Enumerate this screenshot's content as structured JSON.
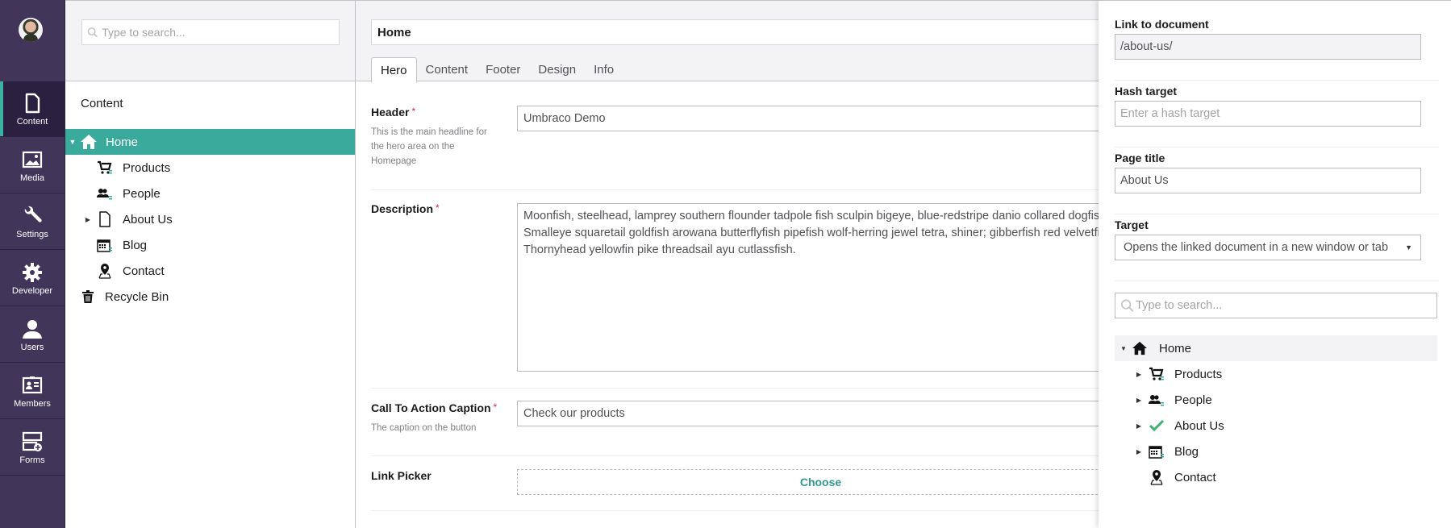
{
  "app_nav": {
    "user": "user-avatar",
    "items": [
      {
        "label": "Content",
        "icon": "document-icon",
        "active": true
      },
      {
        "label": "Media",
        "icon": "image-icon",
        "active": false
      },
      {
        "label": "Settings",
        "icon": "wrench-icon",
        "active": false
      },
      {
        "label": "Developer",
        "icon": "gear-icon",
        "active": false
      },
      {
        "label": "Users",
        "icon": "user-icon",
        "active": false
      },
      {
        "label": "Members",
        "icon": "id-card-icon",
        "active": false
      },
      {
        "label": "Forms",
        "icon": "form-add-icon",
        "active": false
      }
    ]
  },
  "tree": {
    "search_placeholder": "Type to search...",
    "title": "Content",
    "items": [
      {
        "label": "Home",
        "icon": "home-icon",
        "expanded": true,
        "selected": true
      },
      {
        "label": "Products",
        "icon": "shopping-cart-icon"
      },
      {
        "label": "People",
        "icon": "people-icon"
      },
      {
        "label": "About Us",
        "icon": "document-icon",
        "has_children": true
      },
      {
        "label": "Blog",
        "icon": "calendar-icon"
      },
      {
        "label": "Contact",
        "icon": "map-pin-icon"
      },
      {
        "label": "Recycle Bin",
        "icon": "trash-icon"
      }
    ]
  },
  "editor": {
    "node_name": "Home",
    "tabs": [
      {
        "label": "Hero",
        "active": true
      },
      {
        "label": "Content"
      },
      {
        "label": "Footer"
      },
      {
        "label": "Design"
      },
      {
        "label": "Info"
      }
    ],
    "properties": {
      "header": {
        "label": "Header",
        "required": "*",
        "description": "This is the main headline for the hero area on the Homepage",
        "value": "Umbraco Demo"
      },
      "description": {
        "label": "Description",
        "required": "*",
        "value": "Moonfish, steelhead, lamprey southern flounder tadpole fish sculpin bigeye, blue-redstripe danio collared dogfish. Smalleye squaretail goldfish arowana butterflyfish pipefish wolf-herring jewel tetra, shiner; gibberfish red velvetfish. Thornyhead yellowfin pike threadsail ayu cutlassfish."
      },
      "cta": {
        "label": "Call To Action Caption",
        "required": "*",
        "description": "The caption on the button",
        "value": "Check our products"
      },
      "link_picker": {
        "label": "Link Picker",
        "button": "Choose"
      }
    }
  },
  "overlay": {
    "link_label": "Link to document",
    "link_value": "/about-us/",
    "hash_label": "Hash target",
    "hash_placeholder": "Enter a hash target",
    "page_title_label": "Page title",
    "page_title_value": "About Us",
    "target_label": "Target",
    "target_value": "Opens the linked document in a new window or tab",
    "search_placeholder": "Type to search...",
    "tree": [
      {
        "label": "Home",
        "icon": "home-icon",
        "expanded": true,
        "highlighted": true
      },
      {
        "label": "Products",
        "icon": "shopping-cart-icon",
        "has_children": true
      },
      {
        "label": "People",
        "icon": "people-icon",
        "has_children": true
      },
      {
        "label": "About Us",
        "icon": "checkmark-icon",
        "has_children": true,
        "selected": true
      },
      {
        "label": "Blog",
        "icon": "calendar-icon",
        "has_children": true
      },
      {
        "label": "Contact",
        "icon": "map-pin-icon"
      }
    ]
  },
  "colors": {
    "nav_bg": "#413659",
    "accent": "#3aaa9c",
    "required": "#d42054",
    "check": "#3cb371"
  }
}
